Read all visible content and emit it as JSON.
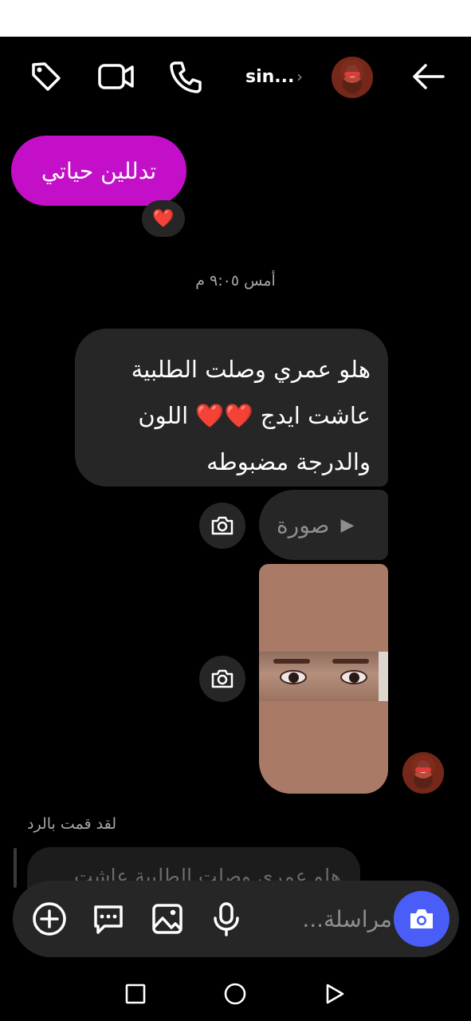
{
  "header": {
    "contact_name": "sin...",
    "chevron": "›",
    "icons": [
      "tag-icon",
      "video-call-icon",
      "phone-icon",
      "back-arrow-icon"
    ]
  },
  "messages": {
    "received_text": "تدللين حياتي",
    "reaction": "❤️",
    "timestamp": "أمس ٩:٠٥ م",
    "sent_text": "هلو عمري وصلت الطلبية\nعاشت ايدج ❤️❤️ اللون\nوالدرجة مضبوطه",
    "photo_label": "صورة"
  },
  "reply": {
    "label": "لقد قمت بالرد",
    "preview_text": "هلو عمري وصلت الطلبية عاشت"
  },
  "composer": {
    "placeholder": "مراسلة...",
    "icons": [
      "add-icon",
      "sticker-icon",
      "gallery-icon",
      "microphone-icon",
      "camera-icon"
    ]
  },
  "navbar": {
    "icons": [
      "recent-apps-icon",
      "home-icon",
      "back-icon"
    ]
  },
  "colors": {
    "background": "#000000",
    "received_bubble": "#c30fc8",
    "sent_bubble": "#262626",
    "composer_camera": "#4a5df9"
  }
}
